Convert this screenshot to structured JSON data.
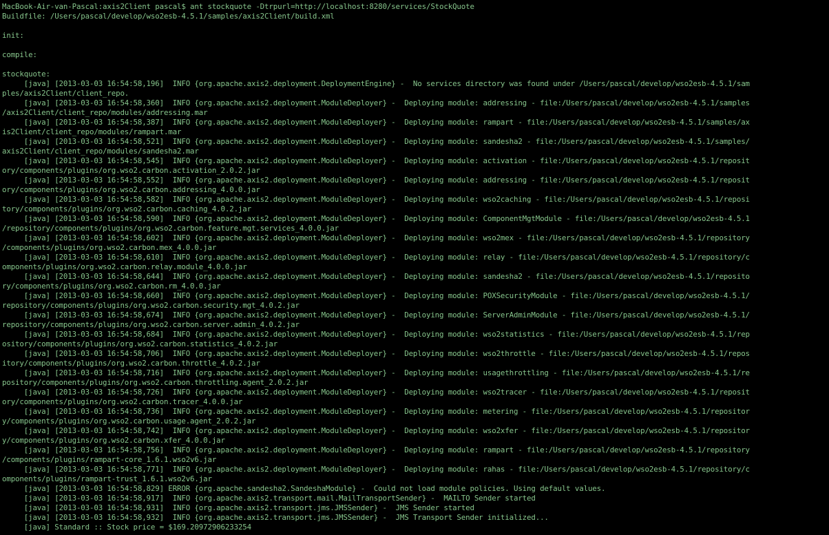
{
  "terminal": {
    "colors": {
      "background": "#000000",
      "text": "#86c48b"
    },
    "lines": [
      "MacBook-Air-van-Pascal:axis2Client pascal$ ant stockquote -Dtrpurl=http://localhost:8280/services/StockQuote",
      "Buildfile: /Users/pascal/develop/wso2esb-4.5.1/samples/axis2Client/build.xml",
      "",
      "init:",
      "",
      "compile:",
      "",
      "stockquote:",
      "     [java] [2013-03-03 16:54:58,196]  INFO {org.apache.axis2.deployment.DeploymentEngine} -  No services directory was found under /Users/pascal/develop/wso2esb-4.5.1/sam",
      "ples/axis2Client/client_repo.",
      "     [java] [2013-03-03 16:54:58,360]  INFO {org.apache.axis2.deployment.ModuleDeployer} -  Deploying module: addressing - file:/Users/pascal/develop/wso2esb-4.5.1/samples",
      "/axis2Client/client_repo/modules/addressing.mar",
      "     [java] [2013-03-03 16:54:58,387]  INFO {org.apache.axis2.deployment.ModuleDeployer} -  Deploying module: rampart - file:/Users/pascal/develop/wso2esb-4.5.1/samples/ax",
      "is2Client/client_repo/modules/rampart.mar",
      "     [java] [2013-03-03 16:54:58,521]  INFO {org.apache.axis2.deployment.ModuleDeployer} -  Deploying module: sandesha2 - file:/Users/pascal/develop/wso2esb-4.5.1/samples/",
      "axis2Client/client_repo/modules/sandesha2.mar",
      "     [java] [2013-03-03 16:54:58,545]  INFO {org.apache.axis2.deployment.ModuleDeployer} -  Deploying module: activation - file:/Users/pascal/develop/wso2esb-4.5.1/reposit",
      "ory/components/plugins/org.wso2.carbon.activation_2.0.2.jar",
      "     [java] [2013-03-03 16:54:58,552]  INFO {org.apache.axis2.deployment.ModuleDeployer} -  Deploying module: addressing - file:/Users/pascal/develop/wso2esb-4.5.1/reposit",
      "ory/components/plugins/org.wso2.carbon.addressing_4.0.0.jar",
      "     [java] [2013-03-03 16:54:58,582]  INFO {org.apache.axis2.deployment.ModuleDeployer} -  Deploying module: wso2caching - file:/Users/pascal/develop/wso2esb-4.5.1/reposi",
      "tory/components/plugins/org.wso2.carbon.caching_4.0.2.jar",
      "     [java] [2013-03-03 16:54:58,590]  INFO {org.apache.axis2.deployment.ModuleDeployer} -  Deploying module: ComponentMgtModule - file:/Users/pascal/develop/wso2esb-4.5.1",
      "/repository/components/plugins/org.wso2.carbon.feature.mgt.services_4.0.0.jar",
      "     [java] [2013-03-03 16:54:58,602]  INFO {org.apache.axis2.deployment.ModuleDeployer} -  Deploying module: wso2mex - file:/Users/pascal/develop/wso2esb-4.5.1/repository",
      "/components/plugins/org.wso2.carbon.mex_4.0.0.jar",
      "     [java] [2013-03-03 16:54:58,610]  INFO {org.apache.axis2.deployment.ModuleDeployer} -  Deploying module: relay - file:/Users/pascal/develop/wso2esb-4.5.1/repository/c",
      "omponents/plugins/org.wso2.carbon.relay.module_4.0.0.jar",
      "     [java] [2013-03-03 16:54:58,644]  INFO {org.apache.axis2.deployment.ModuleDeployer} -  Deploying module: sandesha2 - file:/Users/pascal/develop/wso2esb-4.5.1/reposito",
      "ry/components/plugins/org.wso2.carbon.rm_4.0.0.jar",
      "     [java] [2013-03-03 16:54:58,660]  INFO {org.apache.axis2.deployment.ModuleDeployer} -  Deploying module: POXSecurityModule - file:/Users/pascal/develop/wso2esb-4.5.1/",
      "repository/components/plugins/org.wso2.carbon.security.mgt_4.0.2.jar",
      "     [java] [2013-03-03 16:54:58,674]  INFO {org.apache.axis2.deployment.ModuleDeployer} -  Deploying module: ServerAdminModule - file:/Users/pascal/develop/wso2esb-4.5.1/",
      "repository/components/plugins/org.wso2.carbon.server.admin_4.0.2.jar",
      "     [java] [2013-03-03 16:54:58,684]  INFO {org.apache.axis2.deployment.ModuleDeployer} -  Deploying module: wso2statistics - file:/Users/pascal/develop/wso2esb-4.5.1/rep",
      "ository/components/plugins/org.wso2.carbon.statistics_4.0.2.jar",
      "     [java] [2013-03-03 16:54:58,706]  INFO {org.apache.axis2.deployment.ModuleDeployer} -  Deploying module: wso2throttle - file:/Users/pascal/develop/wso2esb-4.5.1/repos",
      "itory/components/plugins/org.wso2.carbon.throttle_4.0.2.jar",
      "     [java] [2013-03-03 16:54:58,716]  INFO {org.apache.axis2.deployment.ModuleDeployer} -  Deploying module: usagethrottling - file:/Users/pascal/develop/wso2esb-4.5.1/re",
      "pository/components/plugins/org.wso2.carbon.throttling.agent_2.0.2.jar",
      "     [java] [2013-03-03 16:54:58,726]  INFO {org.apache.axis2.deployment.ModuleDeployer} -  Deploying module: wso2tracer - file:/Users/pascal/develop/wso2esb-4.5.1/reposit",
      "ory/components/plugins/org.wso2.carbon.tracer_4.0.0.jar",
      "     [java] [2013-03-03 16:54:58,736]  INFO {org.apache.axis2.deployment.ModuleDeployer} -  Deploying module: metering - file:/Users/pascal/develop/wso2esb-4.5.1/repositor",
      "y/components/plugins/org.wso2.carbon.usage.agent_2.0.2.jar",
      "     [java] [2013-03-03 16:54:58,742]  INFO {org.apache.axis2.deployment.ModuleDeployer} -  Deploying module: wso2xfer - file:/Users/pascal/develop/wso2esb-4.5.1/repositor",
      "y/components/plugins/org.wso2.carbon.xfer_4.0.0.jar",
      "     [java] [2013-03-03 16:54:58,756]  INFO {org.apache.axis2.deployment.ModuleDeployer} -  Deploying module: rampart - file:/Users/pascal/develop/wso2esb-4.5.1/repository",
      "/components/plugins/rampart-core_1.6.1.wso2v6.jar",
      "     [java] [2013-03-03 16:54:58,771]  INFO {org.apache.axis2.deployment.ModuleDeployer} -  Deploying module: rahas - file:/Users/pascal/develop/wso2esb-4.5.1/repository/c",
      "omponents/plugins/rampart-trust_1.6.1.wso2v6.jar",
      "     [java] [2013-03-03 16:54:58,829] ERROR {org.apache.sandesha2.SandeshaModule} -  Could not load module policies. Using default values.",
      "     [java] [2013-03-03 16:54:58,917]  INFO {org.apache.axis2.transport.mail.MailTransportSender} -  MAILTO Sender started",
      "     [java] [2013-03-03 16:54:58,931]  INFO {org.apache.axis2.transport.jms.JMSSender} -  JMS Sender started",
      "     [java] [2013-03-03 16:54:58,932]  INFO {org.apache.axis2.transport.jms.JMSSender} -  JMS Transport Sender initialized...",
      "     [java] Standard :: Stock price = $169.20972906233254"
    ]
  }
}
